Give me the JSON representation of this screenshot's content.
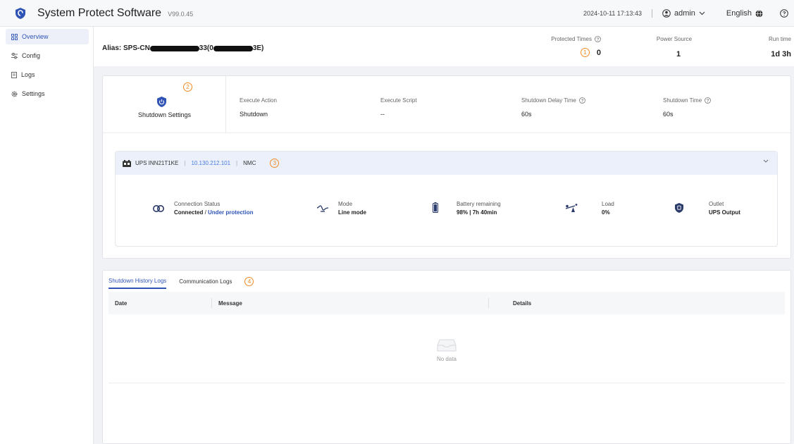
{
  "header": {
    "title": "System Protect Software",
    "version": "V99.0.45",
    "datetime": "2024-10-11 17:13:43",
    "user": "admin",
    "language": "English"
  },
  "sidebar": {
    "items": [
      {
        "label": "Overview",
        "icon": "grid-icon",
        "active": true
      },
      {
        "label": "Config",
        "icon": "sliders-icon",
        "active": false
      },
      {
        "label": "Logs",
        "icon": "document-icon",
        "active": false
      },
      {
        "label": "Settings",
        "icon": "gear-icon",
        "active": false
      }
    ]
  },
  "alias": {
    "prefix": "Alias: SPS-CN",
    "mid": "33(0",
    "suffix": "3E)"
  },
  "metrics": {
    "protected_label": "Protected Times",
    "protected_value": "0",
    "power_label": "Power Source",
    "power_value": "1",
    "runtime_label": "Run time",
    "runtime_value": "1d 3h"
  },
  "callouts": [
    "1",
    "2",
    "3",
    "4"
  ],
  "shutdown": {
    "title": "Shutdown Settings",
    "action_label": "Execute Action",
    "action_value": "Shutdown",
    "script_label": "Execute Script",
    "script_value": "--",
    "delay_label": "Shutdown Delay Time",
    "delay_value": "60s",
    "time_label": "Shutdown Time",
    "time_value": "60s"
  },
  "ups": {
    "name": "UPS INN21T1KE",
    "ip": "10.130.212.101",
    "type": "NMC",
    "connection_label": "Connection Status",
    "connection_value": "Connected",
    "connection_sep": " / ",
    "protection_value": "Under protection",
    "mode_label": "Mode",
    "mode_value": "Line mode",
    "battery_label": "Battery remaining",
    "battery_value": "98% | 7h 40min",
    "load_label": "Load",
    "load_value": "0%",
    "outlet_label": "Outlet",
    "outlet_value": "UPS Output"
  },
  "logs": {
    "tabs": [
      "Shutdown History Logs",
      "Communication Logs"
    ],
    "columns": [
      "Date",
      "Message",
      "Details"
    ],
    "empty_text": "No data"
  },
  "colors": {
    "accent": "#2f54b6",
    "callout": "#f08a24",
    "link": "#4a7be0"
  }
}
